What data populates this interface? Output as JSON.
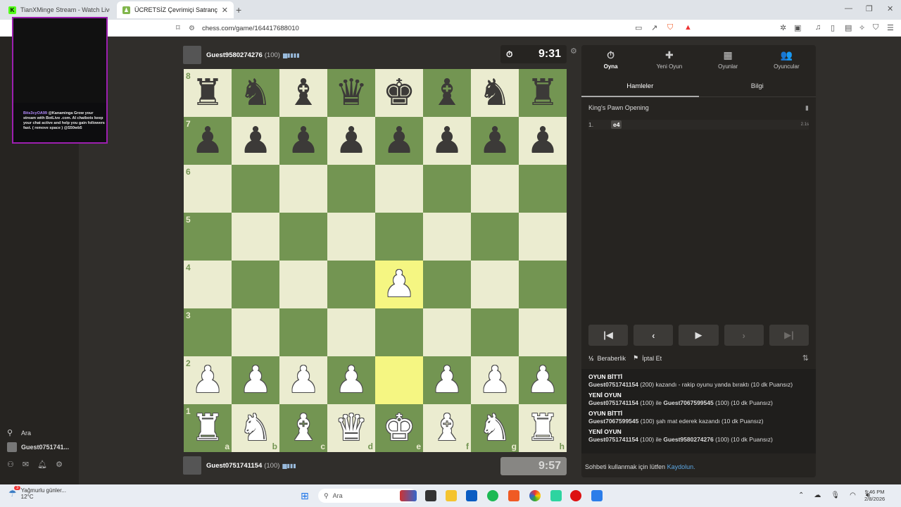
{
  "browser": {
    "tabs": [
      {
        "title": "TianXMinge Stream - Watch Live on",
        "favicon": "K"
      },
      {
        "title": "ÜCRETSİZ Çevrimiçi Satranç Oyn",
        "favicon": "♟"
      }
    ],
    "url": "chess.com/game/164417688010"
  },
  "stream": {
    "chat_user": "Bits3cyOA99",
    "chat_text": "@Kanaminga Grow your stream with BotLive .com. AI chatbots keep your chat active and help you gain followers fast. ( remove space ) @S50wb5"
  },
  "sidebar": {
    "search_label": "Ara",
    "user_label": "Guest0751741..."
  },
  "top_player": {
    "name": "Guest9580274276",
    "rating": "(100)",
    "clock": "9:31"
  },
  "bottom_player": {
    "name": "Guest0751741154",
    "rating": "(100)",
    "clock": "9:57"
  },
  "board": {
    "rows": [
      [
        "br",
        "bn",
        "bb",
        "bq",
        "bk",
        "bb",
        "bn",
        "br"
      ],
      [
        "bp",
        "bp",
        "bp",
        "bp",
        "bp",
        "bp",
        "bp",
        "bp"
      ],
      [
        "",
        "",
        "",
        "",
        "",
        "",
        "",
        ""
      ],
      [
        "",
        "",
        "",
        "",
        "",
        "",
        "",
        ""
      ],
      [
        "",
        "",
        "",
        "",
        "wp",
        "",
        "",
        ""
      ],
      [
        "",
        "",
        "",
        "",
        "",
        "",
        "",
        ""
      ],
      [
        "wp",
        "wp",
        "wp",
        "wp",
        "",
        "wp",
        "wp",
        "wp"
      ],
      [
        "wr",
        "wn",
        "wb",
        "wq",
        "wk",
        "wb",
        "wn",
        "wr"
      ]
    ],
    "highlight": [
      "e4",
      "e2"
    ],
    "ranks": [
      "8",
      "7",
      "6",
      "5",
      "4",
      "3",
      "2",
      "1"
    ],
    "files": [
      "a",
      "b",
      "c",
      "d",
      "e",
      "f",
      "g",
      "h"
    ]
  },
  "panel": {
    "nav": [
      {
        "label": "Oyna",
        "icon": "stopwatch-icon",
        "glyph": "⏱"
      },
      {
        "label": "Yeni Oyun",
        "icon": "plus-icon",
        "glyph": "✚"
      },
      {
        "label": "Oyunlar",
        "icon": "board-icon",
        "glyph": "▦"
      },
      {
        "label": "Oyuncular",
        "icon": "players-icon",
        "glyph": "👥"
      }
    ],
    "tabs": [
      "Hamleler",
      "Bilgi"
    ],
    "opening": "King's Pawn Opening",
    "move_number": "1.",
    "move": "e4",
    "move_time": "2.1s",
    "draw_label": "Beraberlik",
    "draw_icon": "½",
    "abort_label": "İptal Et",
    "log": [
      {
        "header": "OYUN BİTTİ",
        "parts": [
          {
            "t": "Guest0751741154",
            "b": true
          },
          {
            "t": " (200) kazandı - rakip oyunu yanda bıraktı (10 dk Puansız)",
            "b": false
          }
        ]
      },
      {
        "header": "YENİ OYUN",
        "parts": [
          {
            "t": "Guest0751741154",
            "b": true
          },
          {
            "t": " (100) ile ",
            "b": false
          },
          {
            "t": "Guest7067599545",
            "b": true
          },
          {
            "t": " (100) (10 dk Puansız)",
            "b": false
          }
        ]
      },
      {
        "header": "OYUN BİTTİ",
        "parts": [
          {
            "t": "Guest7067599545",
            "b": true
          },
          {
            "t": " (100) şah mat ederek kazandı (10 dk Puansız)",
            "b": false
          }
        ]
      },
      {
        "header": "YENİ OYUN",
        "parts": [
          {
            "t": "Guest0751741154",
            "b": true
          },
          {
            "t": " (100) ile ",
            "b": false
          },
          {
            "t": "Guest9580274276",
            "b": true
          },
          {
            "t": " (100) (10 dk Puansız)",
            "b": false
          }
        ]
      }
    ],
    "chat_note": "Sohbeti kullanmak için lütfen",
    "chat_link": "Kaydolun."
  },
  "taskbar": {
    "weather_text": "Yağmurlu günler...",
    "temp": "12°C",
    "notify_badge": "3",
    "search_label": "Ara",
    "time": "9:46 PM",
    "date": "2/8/2026"
  },
  "colors": {
    "light_square": "#ebecd0",
    "dark_square": "#739552",
    "highlight": "#f5f682",
    "panel": "#262421"
  }
}
